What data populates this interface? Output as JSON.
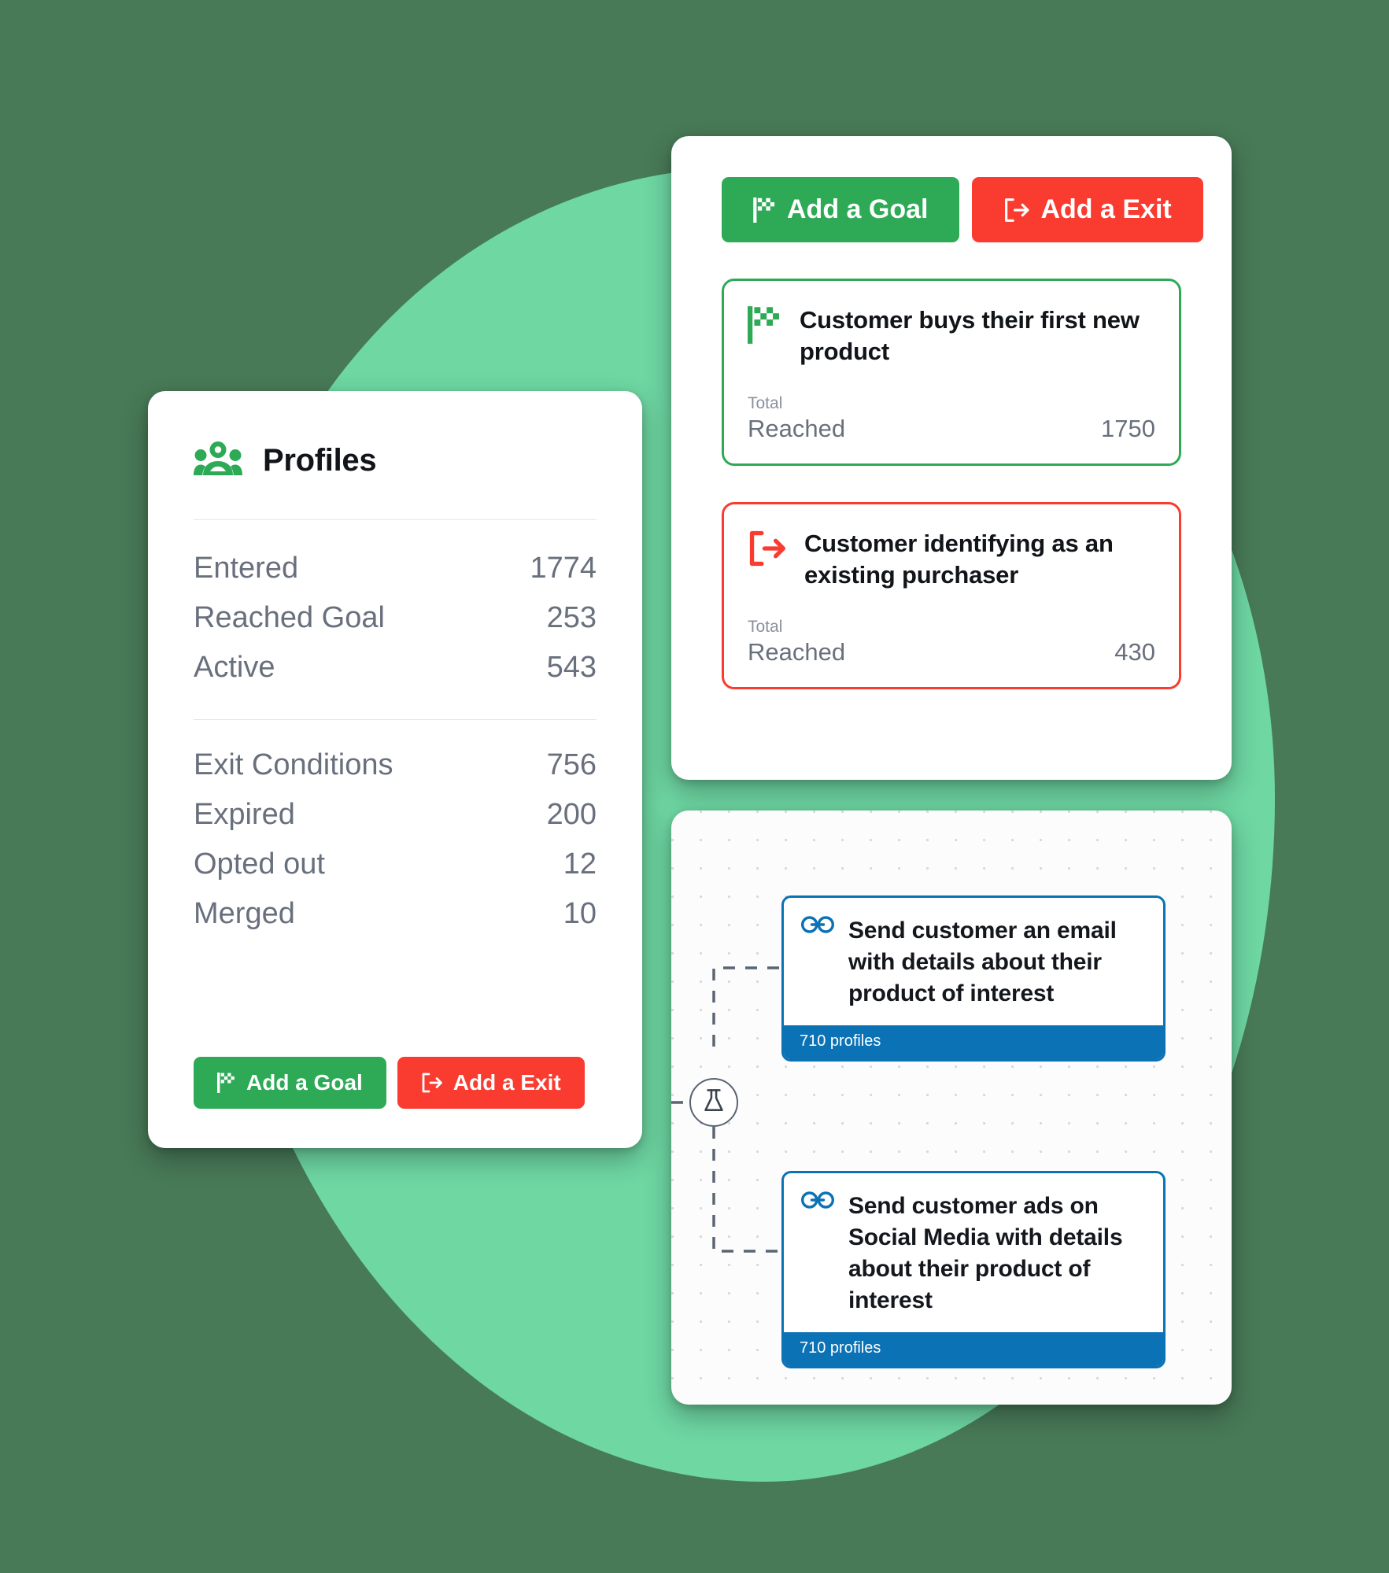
{
  "theme": {
    "background": "#487a57",
    "blob": "#6ed7a2",
    "green": "#2eaa57",
    "red": "#f93b30",
    "blue": "#0b72b5",
    "text_muted": "#69707d",
    "text_dark": "#111418"
  },
  "profiles_card": {
    "icon": "people-group-icon",
    "title": "Profiles",
    "stats_primary": [
      {
        "label": "Entered",
        "value": "1774"
      },
      {
        "label": "Reached Goal",
        "value": "253"
      },
      {
        "label": "Active",
        "value": "543"
      }
    ],
    "stats_secondary": [
      {
        "label": "Exit Conditions",
        "value": "756"
      },
      {
        "label": "Expired",
        "value": "200"
      },
      {
        "label": "Opted out",
        "value": "12"
      },
      {
        "label": "Merged",
        "value": "10"
      }
    ],
    "actions": {
      "add_goal": "Add a Goal",
      "add_exit": "Add a Exit"
    }
  },
  "goals_card": {
    "actions": {
      "add_goal": "Add a Goal",
      "add_exit": "Add a Exit"
    },
    "items": [
      {
        "kind": "goal",
        "icon": "checkered-flag-icon",
        "title": "Customer buys their first new product",
        "metric_label_top": "Total",
        "metric_label_bottom": "Reached",
        "metric_value": "1750"
      },
      {
        "kind": "exit",
        "icon": "exit-arrow-icon",
        "title": "Customer identifying as an existing purchaser",
        "metric_label_top": "Total",
        "metric_label_bottom": "Reached",
        "metric_value": "430"
      }
    ]
  },
  "flow_card": {
    "split_icon": "flask-split-icon",
    "nodes": [
      {
        "icon": "link-icon",
        "text": "Send customer an email with details about their product of interest",
        "footer": "710 profiles"
      },
      {
        "icon": "link-icon",
        "text": "Send customer ads on Social Media with details about their product of interest",
        "footer": "710 profiles"
      }
    ]
  }
}
